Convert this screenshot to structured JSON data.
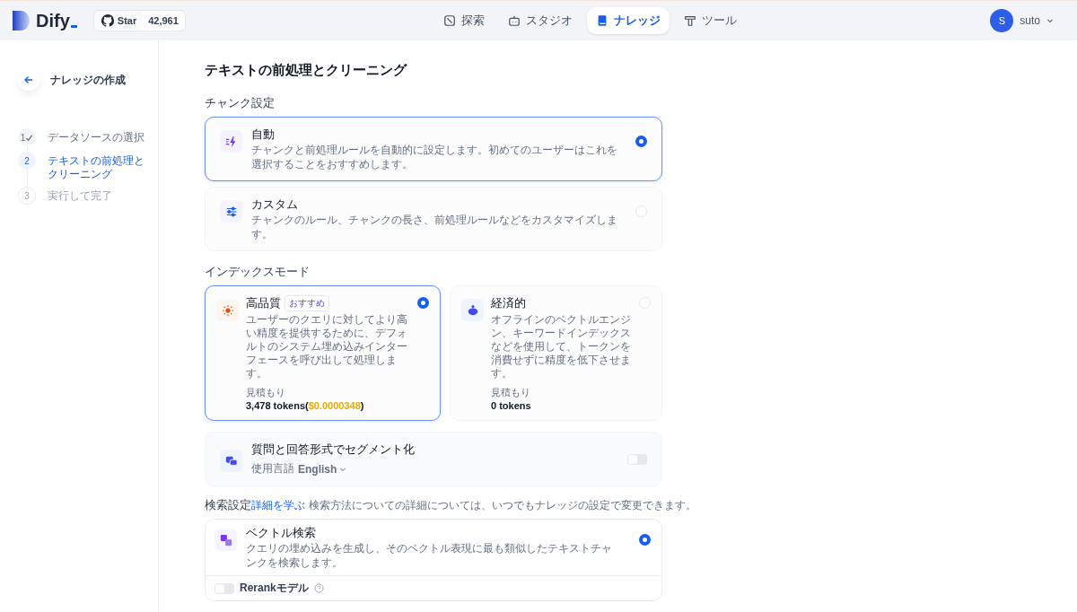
{
  "header": {
    "logo": "Dify",
    "github": {
      "label": "Star",
      "count": "42,961"
    },
    "nav": [
      {
        "label": "探索",
        "selected": false
      },
      {
        "label": "スタジオ",
        "selected": false
      },
      {
        "label": "ナレッジ",
        "selected": true
      },
      {
        "label": "ツール",
        "selected": false
      }
    ],
    "user": {
      "initial": "S",
      "name": "suto"
    }
  },
  "sidebar": {
    "title": "ナレッジの作成",
    "steps": [
      {
        "number": "1",
        "label": "データソースの選択",
        "done": true,
        "selected": false
      },
      {
        "number": "2",
        "label": "テキストの前処理とクリーニング",
        "done": false,
        "selected": true
      },
      {
        "number": "3",
        "label": "実行して完了",
        "done": false,
        "selected": false
      }
    ]
  },
  "page_title": "テキストの前処理とクリーニング",
  "chunk": {
    "heading": "チャンク設定",
    "options": [
      {
        "title": "自動",
        "description": "チャンクと前処理ルールを自動的に設定します。初めてのユーザーはこれを選択することをおすすめします。",
        "selected": true
      },
      {
        "title": "カスタム",
        "description": "チャンクのルール、チャンクの長さ、前処理ルールなどをカスタマイズします。",
        "selected": false
      }
    ]
  },
  "index": {
    "heading": "インデックスモード",
    "modes": [
      {
        "title": "高品質",
        "badge": "おすすめ",
        "description": "ユーザーのクエリに対してより高い精度を提供するために、デフォルトのシステム埋め込みインターフェースを呼び出して処理します。",
        "estimate_label": "見積もり",
        "tokens": "3,478 tokens(",
        "cost": "$0.0000348",
        "tokens_end": ")",
        "selected": true
      },
      {
        "title": "経済的",
        "description": "オフラインのベクトルエンジン、キーワードインデックスなどを使用して、トークンを消費せずに精度を低下させます。",
        "estimate_label": "見積もり",
        "tokens": "0 tokens",
        "selected": false
      }
    ]
  },
  "qa": {
    "title": "質問と回答形式でセグメント化",
    "language_label": "使用言語",
    "language": "English",
    "on": false
  },
  "retrieval": {
    "heading": "検索設定",
    "link": "詳細を学ぶ",
    "note": "検索方法についての詳細については、いつでもナレッジの設定で変更できます。",
    "methods": [
      {
        "title": "ベクトル検索",
        "description": "クエリの埋め込みを生成し、そのベクトル表現に最も類似したテキストチャンクを検索します。",
        "selected": true
      }
    ],
    "rerank": {
      "label": "Rerankモデル",
      "on": false
    }
  }
}
